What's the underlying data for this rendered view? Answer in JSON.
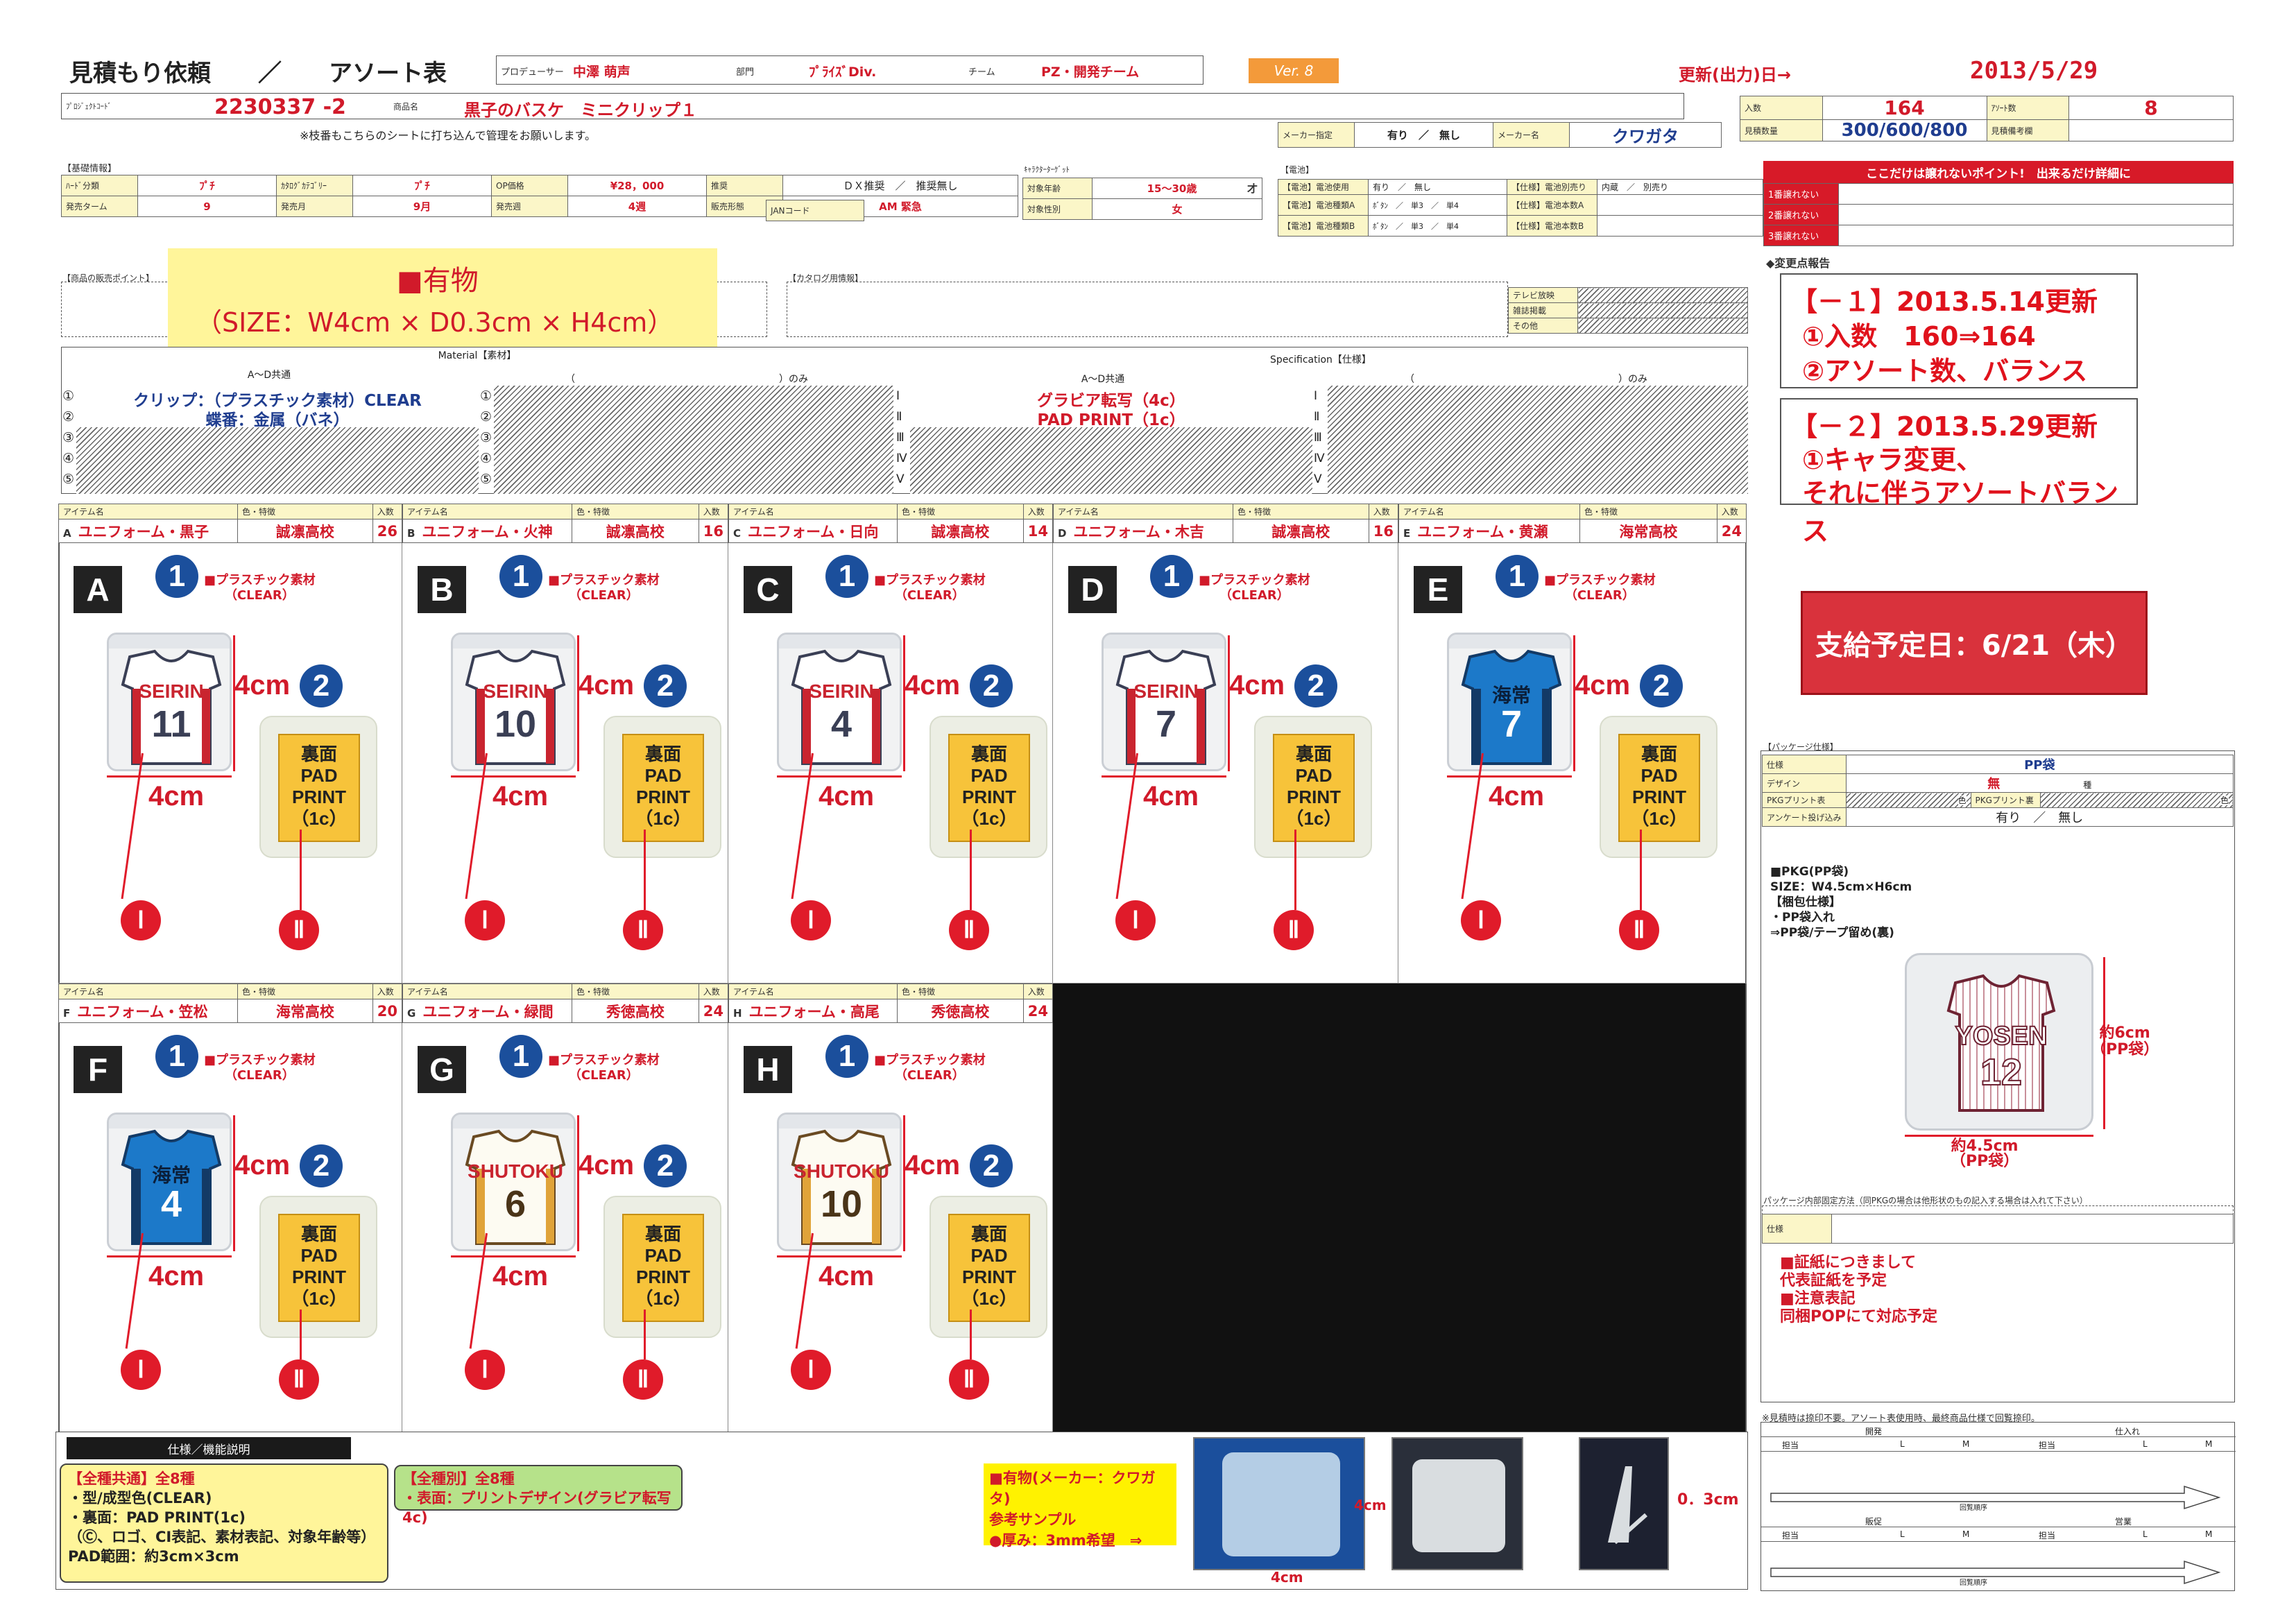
{
  "header": {
    "title": "見積もり依頼　　／　　アソート表",
    "producer_label": "プロデューサー",
    "producer": "中澤 萌声",
    "dept_label": "部門",
    "dept": "ﾌﾟﾗｲｽﾞDiv.",
    "team_label": "チーム",
    "team": "PZ・開発チーム",
    "version": "Ver. 8",
    "update_label": "更新(出力)日→",
    "update_date": "2013/5/29"
  },
  "project": {
    "code_label": "ﾌﾟﾛｼﾞｪｸﾄｺｰﾄﾞ",
    "code": "2230337 -2",
    "name_label": "商品名",
    "name": "黒子のバスケ　ミニクリップ１",
    "note": "※枝番もこちらのシートに打ち込んで管理をお願いします。",
    "qty_label": "入数",
    "qty": "164",
    "assort_label": "ｱｿｰﾄ数",
    "assort": "8",
    "est_label": "見積数量",
    "est": "300/600/800",
    "est_note_label": "見積備考欄",
    "maker_label": "メーカー指定",
    "maker_choice": "有り　／　無し",
    "maker_name_label": "メーカー名",
    "maker_name": "クワガタ"
  },
  "basic": {
    "section": "【基礎情報】",
    "hard_label": "ﾊｰﾄﾞ分類",
    "hard": "ﾌﾟﾁ",
    "catalog_label": "ｶﾀﾛｸﾞｶﾃｺﾞﾘｰ",
    "catalog": "ﾌﾟﾁ",
    "op_label": "OP価格",
    "op": "¥28，000",
    "recommend_label": "推奨",
    "recommend": "ＤＸ推奨　／　推奨無し",
    "term_label": "発売ターム",
    "term": "9",
    "month_label": "発売月",
    "month": "9月",
    "week_label": "発売週",
    "week": "4週",
    "form_label": "販売形態",
    "form": "AM 緊急",
    "jan_label": "JANコード",
    "chara_label": "ｷｬﾗｸﾀｰﾀｰｹﾞｯﾄ",
    "age_label": "対象年齢",
    "age": "15～30歳",
    "age_unit": "才",
    "sex_label": "対象性別",
    "sex": "女"
  },
  "battery": {
    "section": "【電池】",
    "use_label": "【電池】電池使用",
    "use": "有り　／　無し",
    "sep_label": "【仕様】電池別売り",
    "sep": "内蔵　／　別売り",
    "typeA_label": "【電池】電池種類A",
    "typeA": "ﾎﾞﾀﾝ　／　単3　／　単4",
    "numA_label": "【仕様】電池本数A",
    "typeB_label": "【電池】電池種類B",
    "typeB": "ﾎﾞﾀﾝ　／　単3　／　単4",
    "numB_label": "【仕様】電池本数B"
  },
  "points": {
    "title": "ここだけは譲れないポイント!　出来るだけ詳細に",
    "rows": [
      "1番譲れない",
      "2番譲れない",
      "3番譲れない"
    ],
    "change_label": "◆変更点報告",
    "change1_title": "【－１】2013.5.14更新",
    "change1_l1": "①入数　160⇒164",
    "change1_l2": "②アソート数、バランス",
    "change2_title": "【－２】2013.5.29更新",
    "change2_l1": "①キャラ変更、",
    "change2_l2": "それに伴うアソートバランス",
    "supply": "支給予定日：6/21（木）"
  },
  "product": {
    "section": "【商品の販売ポイント】",
    "catalog_section": "【カタログ用情報】",
    "sample_title": "■有物",
    "sample_size": "（SIZE：W4cm × D0.3cm × H4cm）",
    "tv": "テレビ放映",
    "magazine": "雑誌掲載",
    "other": "その他"
  },
  "material": {
    "title": "Material【素材】",
    "common": "A～D共通",
    "only": "（　　　　　　　　　　　　　　　　　　　　　）のみ",
    "row1": "クリップ：（プラスチック素材）CLEAR",
    "row2": "蝶番：金属（バネ）",
    "nums": [
      "①",
      "②",
      "③",
      "④",
      "⑤"
    ]
  },
  "spec": {
    "title": "Specification【仕様】",
    "common": "A～D共通",
    "only": "（　　　　　　　　　　　　　　　　　　　　　）のみ",
    "row1": "グラビア転写（4c）",
    "row2": "PAD PRINT（1c）",
    "nums": [
      "Ⅰ",
      "Ⅱ",
      "Ⅲ",
      "Ⅳ",
      "Ⅴ"
    ]
  },
  "item_header": {
    "name": "アイテム名",
    "color": "色・特徴",
    "qty": "入数"
  },
  "items": [
    {
      "letter": "A",
      "name": "ユニフォーム・黒子",
      "color": "誠凛高校",
      "qty": "26",
      "num": "11",
      "team": "SEIRIN",
      "jersey": "white"
    },
    {
      "letter": "B",
      "name": "ユニフォーム・火神",
      "color": "誠凛高校",
      "qty": "16",
      "num": "10",
      "team": "SEIRIN",
      "jersey": "white"
    },
    {
      "letter": "C",
      "name": "ユニフォーム・日向",
      "color": "誠凛高校",
      "qty": "14",
      "num": "4",
      "team": "SEIRIN",
      "jersey": "white"
    },
    {
      "letter": "D",
      "name": "ユニフォーム・木吉",
      "color": "誠凛高校",
      "qty": "16",
      "num": "7",
      "team": "SEIRIN",
      "jersey": "white"
    },
    {
      "letter": "E",
      "name": "ユニフォーム・黄瀬",
      "color": "海常高校",
      "qty": "24",
      "num": "7",
      "team": "海常",
      "jersey": "blue"
    },
    {
      "letter": "F",
      "name": "ユニフォーム・笠松",
      "color": "海常高校",
      "qty": "20",
      "num": "4",
      "team": "海常",
      "jersey": "blue"
    },
    {
      "letter": "G",
      "name": "ユニフォーム・緑間",
      "color": "秀徳高校",
      "qty": "24",
      "num": "6",
      "team": "SHUTOKU",
      "jersey": "cream"
    },
    {
      "letter": "H",
      "name": "ユニフォーム・高尾",
      "color": "秀徳高校",
      "qty": "24",
      "num": "10",
      "team": "SHUTOKU",
      "jersey": "cream"
    }
  ],
  "labels": {
    "plastic": "■プラスチック素材",
    "clear": "（CLEAR）",
    "dim": "4cm",
    "back1": "裏面",
    "back2": "PAD",
    "back3": "PRINT",
    "back4": "（1c）",
    "c1": "1",
    "c2": "2",
    "r1": "Ⅰ",
    "r2": "Ⅱ"
  },
  "package": {
    "section": "【パッケージ仕様】",
    "spec_label": "仕様",
    "spec": "PP袋",
    "design_label": "デザイン",
    "design_l": "無",
    "design_r": "種",
    "pkg_front_label": "PKGプリント表",
    "pkg_front": "色",
    "pkg_back_label": "PKGプリント裏",
    "pkg_back": "色",
    "survey_label": "アンケート投げ込み",
    "survey": "有り　／　無し",
    "notes": [
      "■PKG(PP袋)",
      "SIZE：W4.5cm×H6cm",
      "【梱包仕様】",
      "・PP袋入れ",
      "⇒PP袋/テープ留め(裏)"
    ],
    "preview_team": "YOSEN",
    "preview_num": "12",
    "h_dim": "約6cm",
    "h_dim2": "（PP袋）",
    "w_dim": "約4.5cm",
    "w_dim2": "（PP袋）",
    "inner_label": "パッケージ内部固定方法（同PKGの場合は他形状のもの記入する場合は入れて下さい）",
    "spec2_label": "仕様"
  },
  "certificate": {
    "lines": [
      "■証紙につきまして",
      "代表証紙を予定",
      "■注意表記",
      "同梱POPにて対応予定"
    ]
  },
  "approval": {
    "note": "※見積時は捺印不要。アソート表使用時、最終商品仕様で回覧捺印。",
    "dev": "開発",
    "buy": "仕入れ",
    "sales": "販促",
    "biz": "営業",
    "tanto": "担当",
    "l": "L",
    "m": "M",
    "flow": "回覧順序"
  },
  "bottom": {
    "title": "仕様／機能説明",
    "common_title": "【全種共通】全8種",
    "common_lines": [
      "・型/成型色(CLEAR)",
      "・裏面：PAD PRINT(1c)",
      "（Ⓒ、ロゴ、CI表記、素材表記、対象年齢等）",
      "PAD範囲：約3cm×3cm"
    ],
    "each_title": "【全種別】全8種",
    "each_line": "・表面：プリントデザイン(グラビア転写4c)",
    "sample_lines": [
      "■有物(メーカー：クワガタ)",
      "参考サンプル",
      "●厚み：3mm希望　⇒"
    ],
    "dim_4cm": "4cm",
    "dim_03": "0．3cm"
  },
  "colors": {
    "red": "#d11a2a",
    "blue": "#1b4f9c",
    "yellow": "#fff59a",
    "orange": "#f39a3a",
    "header_red": "#d71a28"
  }
}
